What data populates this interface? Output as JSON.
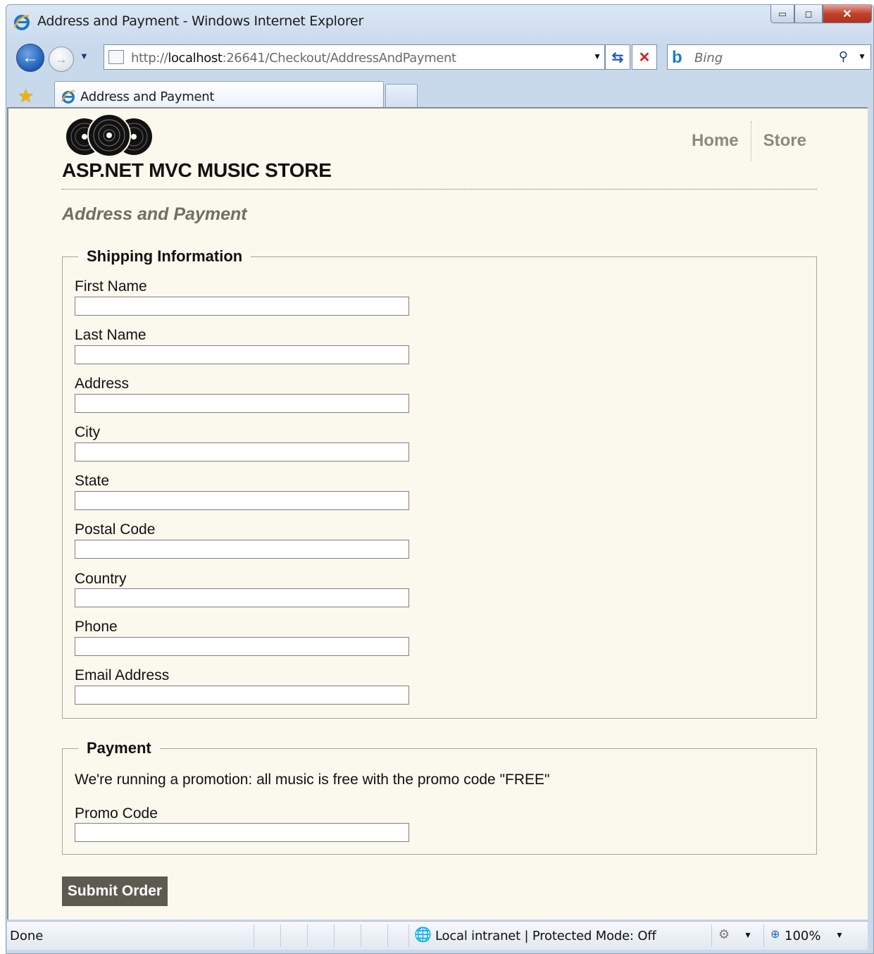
{
  "browser": {
    "window_title": "Address and Payment - Windows Internet Explorer",
    "address_url_prefix": "http://",
    "address_url_host": "localhost",
    "address_url_rest": ":26641/Checkout/AddressAndPayment",
    "search_placeholder": "Bing",
    "tab_title": "Address and Payment",
    "status_text": "Done",
    "zone_text": "Local intranet | Protected Mode: Off",
    "zoom_text": "100%",
    "icons": {
      "back": "back-arrow-icon",
      "forward": "forward-arrow-icon",
      "refresh": "refresh-icon",
      "stop": "stop-icon",
      "search": "search-icon",
      "favorites": "favorites-star-icon"
    }
  },
  "site": {
    "title": "ASP.NET MVC MUSIC STORE",
    "nav": [
      "Home",
      "Store"
    ]
  },
  "page": {
    "heading": "Address and Payment",
    "shipping": {
      "legend": "Shipping Information",
      "fields": [
        {
          "label": "First Name",
          "value": ""
        },
        {
          "label": "Last Name",
          "value": ""
        },
        {
          "label": "Address",
          "value": ""
        },
        {
          "label": "City",
          "value": ""
        },
        {
          "label": "State",
          "value": ""
        },
        {
          "label": "Postal Code",
          "value": ""
        },
        {
          "label": "Country",
          "value": ""
        },
        {
          "label": "Phone",
          "value": ""
        },
        {
          "label": "Email Address",
          "value": ""
        }
      ]
    },
    "payment": {
      "legend": "Payment",
      "note": "We're running a promotion: all music is free with the promo code \"FREE\"",
      "promo_label": "Promo Code",
      "promo_value": ""
    },
    "submit_label": "Submit Order"
  }
}
